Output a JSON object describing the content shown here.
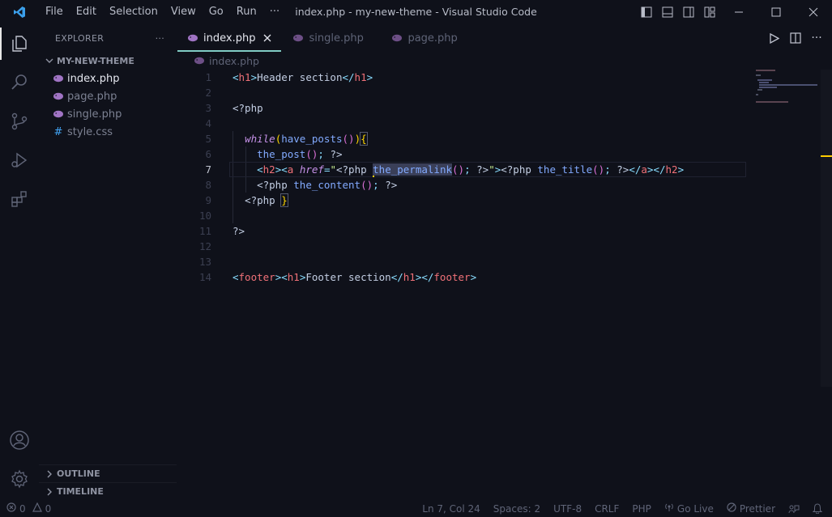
{
  "window": {
    "title": "index.php - my-new-theme - Visual Studio Code",
    "menu": [
      "File",
      "Edit",
      "Selection",
      "View",
      "Go",
      "Run",
      "···"
    ]
  },
  "activity_icons": [
    "explorer-icon",
    "search-icon",
    "source-control-icon",
    "run-debug-icon",
    "extensions-icon",
    "account-icon",
    "settings-gear-icon"
  ],
  "sidebar": {
    "title": "EXPLORER",
    "more": "···",
    "folder": "MY-NEW-THEME",
    "files": [
      {
        "name": "index.php",
        "icon": "php-elephant-icon",
        "active": true
      },
      {
        "name": "page.php",
        "icon": "php-elephant-icon",
        "active": false
      },
      {
        "name": "single.php",
        "icon": "php-elephant-icon",
        "active": false
      },
      {
        "name": "style.css",
        "icon": "hash-icon",
        "active": false
      }
    ],
    "outline": "OUTLINE",
    "timeline": "TIMELINE"
  },
  "tabs": [
    {
      "label": "index.php",
      "active": true,
      "close": "✕"
    },
    {
      "label": "single.php",
      "active": false
    },
    {
      "label": "page.php",
      "active": false
    }
  ],
  "breadcrumb": "index.php",
  "code": {
    "line_numbers": [
      "1",
      "2",
      "3",
      "4",
      "5",
      "6",
      "7",
      "8",
      "9",
      "10",
      "11",
      "12",
      "13",
      "14"
    ],
    "current_line": 7
  },
  "status": {
    "errors": "0",
    "warnings": "0",
    "position": "Ln 7, Col 24",
    "spaces": "Spaces: 2",
    "encoding": "UTF-8",
    "eol": "CRLF",
    "language": "PHP",
    "golive": "Go Live",
    "prettier": "Prettier"
  },
  "colors": {
    "background": "#0f111a",
    "accent": "#80cbc4",
    "php_icon": "#a074c4",
    "css_icon": "#42a5f5"
  }
}
